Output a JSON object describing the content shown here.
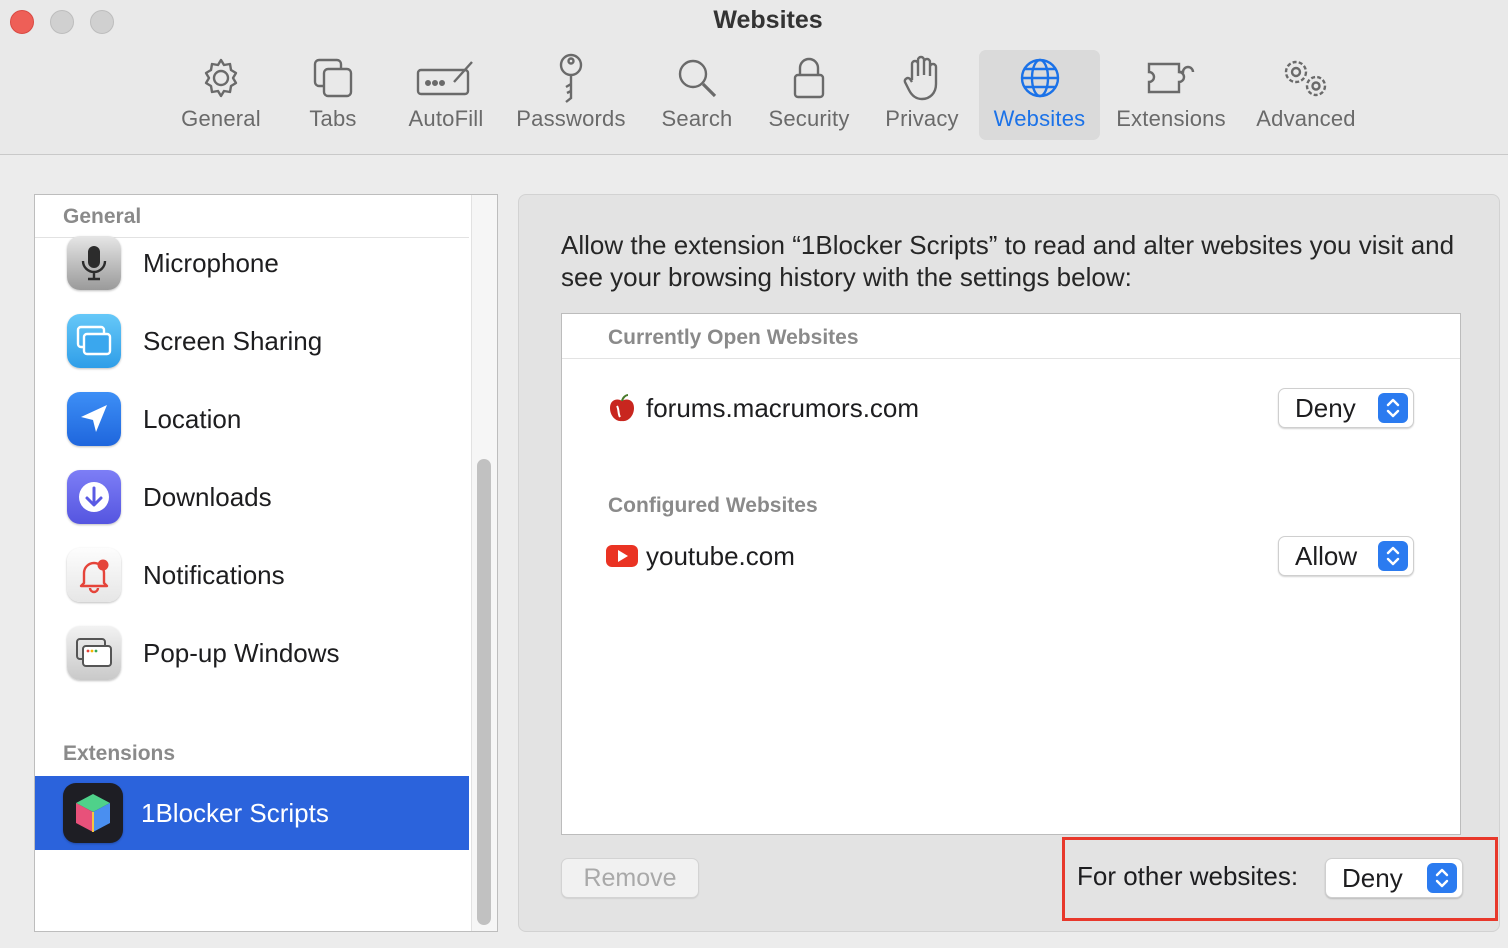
{
  "window": {
    "title": "Websites",
    "traffic_lights": [
      "close",
      "minimize",
      "zoom"
    ]
  },
  "toolbar": {
    "items": [
      {
        "label": "General",
        "icon": "gear-icon"
      },
      {
        "label": "Tabs",
        "icon": "tabs-icon"
      },
      {
        "label": "AutoFill",
        "icon": "autofill-icon"
      },
      {
        "label": "Passwords",
        "icon": "key-icon"
      },
      {
        "label": "Search",
        "icon": "magnifier-icon"
      },
      {
        "label": "Security",
        "icon": "lock-icon"
      },
      {
        "label": "Privacy",
        "icon": "hand-icon"
      },
      {
        "label": "Websites",
        "icon": "globe-icon",
        "active": true
      },
      {
        "label": "Extensions",
        "icon": "puzzle-icon"
      },
      {
        "label": "Advanced",
        "icon": "gears-icon"
      }
    ],
    "active_color": "#1b72e8"
  },
  "sidebar": {
    "general_header": "General",
    "items": [
      {
        "label": "Microphone",
        "icon": "microphone-icon"
      },
      {
        "label": "Screen Sharing",
        "icon": "screen-sharing-icon"
      },
      {
        "label": "Location",
        "icon": "location-arrow-icon"
      },
      {
        "label": "Downloads",
        "icon": "download-icon"
      },
      {
        "label": "Notifications",
        "icon": "bell-icon"
      },
      {
        "label": "Pop-up Windows",
        "icon": "popup-windows-icon"
      }
    ],
    "extensions_header": "Extensions",
    "extension_items": [
      {
        "label": "1Blocker Scripts",
        "icon": "1blocker-cube-icon",
        "selected": true
      }
    ],
    "selection_color": "#2b63dc"
  },
  "main": {
    "description": "Allow the extension “1Blocker Scripts” to read and alter websites you visit and see your browsing history with the settings below:",
    "currently_open_header": "Currently Open Websites",
    "currently_open": [
      {
        "site": "forums.macrumors.com",
        "value": "Deny",
        "icon": "macrumors-apple-icon"
      }
    ],
    "configured_header": "Configured Websites",
    "configured": [
      {
        "site": "youtube.com",
        "value": "Allow",
        "icon": "youtube-icon"
      }
    ],
    "remove_label": "Remove",
    "other_websites_label": "For other websites:",
    "other_websites_value": "Deny",
    "highlight_color": "#e8382b"
  }
}
